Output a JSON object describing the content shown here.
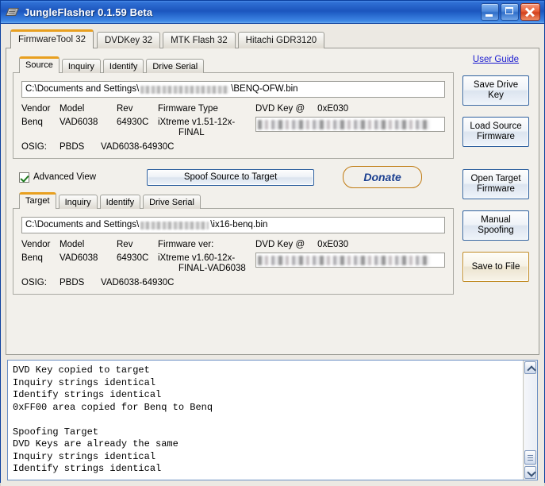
{
  "window": {
    "title": "JungleFlasher 0.1.59 Beta",
    "icon": "chip-icon",
    "minimize_label": "Minimize",
    "maximize_label": "Maximize",
    "close_label": "Close"
  },
  "main_tabs": [
    {
      "label": "FirmwareTool 32",
      "active": true
    },
    {
      "label": "DVDKey 32",
      "active": false
    },
    {
      "label": "MTK Flash 32",
      "active": false
    },
    {
      "label": "Hitachi GDR3120",
      "active": false
    }
  ],
  "source_panel": {
    "tabs": [
      {
        "label": "Source",
        "active": true
      },
      {
        "label": "Inquiry",
        "active": false
      },
      {
        "label": "Identify",
        "active": false
      },
      {
        "label": "Drive Serial",
        "active": false
      }
    ],
    "path_prefix": "C:\\Documents and Settings\\",
    "path_suffix": "\\BENQ-OFW.bin",
    "path_redacted": true,
    "headers": {
      "vendor": "Vendor",
      "model": "Model",
      "rev": "Rev",
      "firmware": "Firmware Type"
    },
    "values": {
      "vendor": "Benq",
      "model": "VAD6038",
      "rev": "64930C",
      "firmware_line1": "iXtreme v1.51-12x-",
      "firmware_line2": "FINAL"
    },
    "osig": {
      "label": "OSIG:",
      "vendor": "PBDS",
      "value": "VAD6038-64930C"
    },
    "dvd_key": {
      "label": "DVD Key @",
      "address": "0xE030",
      "value_redacted": true
    }
  },
  "middle": {
    "advanced_view_label": "Advanced View",
    "advanced_view_checked": true,
    "spoof_button": "Spoof Source to Target",
    "donate_button": "Donate"
  },
  "target_panel": {
    "tabs": [
      {
        "label": "Target",
        "active": true
      },
      {
        "label": "Inquiry",
        "active": false
      },
      {
        "label": "Identify",
        "active": false
      },
      {
        "label": "Drive Serial",
        "active": false
      }
    ],
    "path_prefix": "C:\\Documents and Settings\\",
    "path_suffix": "\\ix16-benq.bin",
    "path_redacted": true,
    "headers": {
      "vendor": "Vendor",
      "model": "Model",
      "rev": "Rev",
      "firmware": "Firmware ver:"
    },
    "values": {
      "vendor": "Benq",
      "model": "VAD6038",
      "rev": "64930C",
      "firmware_line1": "iXtreme v1.60-12x-",
      "firmware_line2": "FINAL-VAD6038"
    },
    "osig": {
      "label": "OSIG:",
      "vendor": "PBDS",
      "value": "VAD6038-64930C"
    },
    "dvd_key": {
      "label": "DVD Key @",
      "address": "0xE030",
      "value_redacted": true
    }
  },
  "sidebar": {
    "user_guide": "User Guide",
    "buttons": [
      {
        "label": "Save Drive Key",
        "highlight": false
      },
      {
        "label": "Load Source Firmware",
        "highlight": false
      },
      {
        "label": "Open Target Firmware",
        "highlight": false
      },
      {
        "label": "Manual Spoofing",
        "highlight": false
      },
      {
        "label": "Save to File",
        "highlight": true
      }
    ]
  },
  "log": {
    "text": "DVD Key copied to target\nInquiry strings identical\nIdentify strings identical\n0xFF00 area copied for Benq to Benq\n\nSpoofing Target\nDVD Keys are already the same\nInquiry strings identical\nIdentify strings identical",
    "scroll_up_label": "Scroll up",
    "scroll_down_label": "Scroll down"
  },
  "colors": {
    "titlebar_blue": "#1c55bd",
    "tab_accent_orange": "#e8a020",
    "link_blue": "#1a1ad0",
    "donate_orange": "#ef9d13",
    "check_green": "#1d7a1d"
  }
}
